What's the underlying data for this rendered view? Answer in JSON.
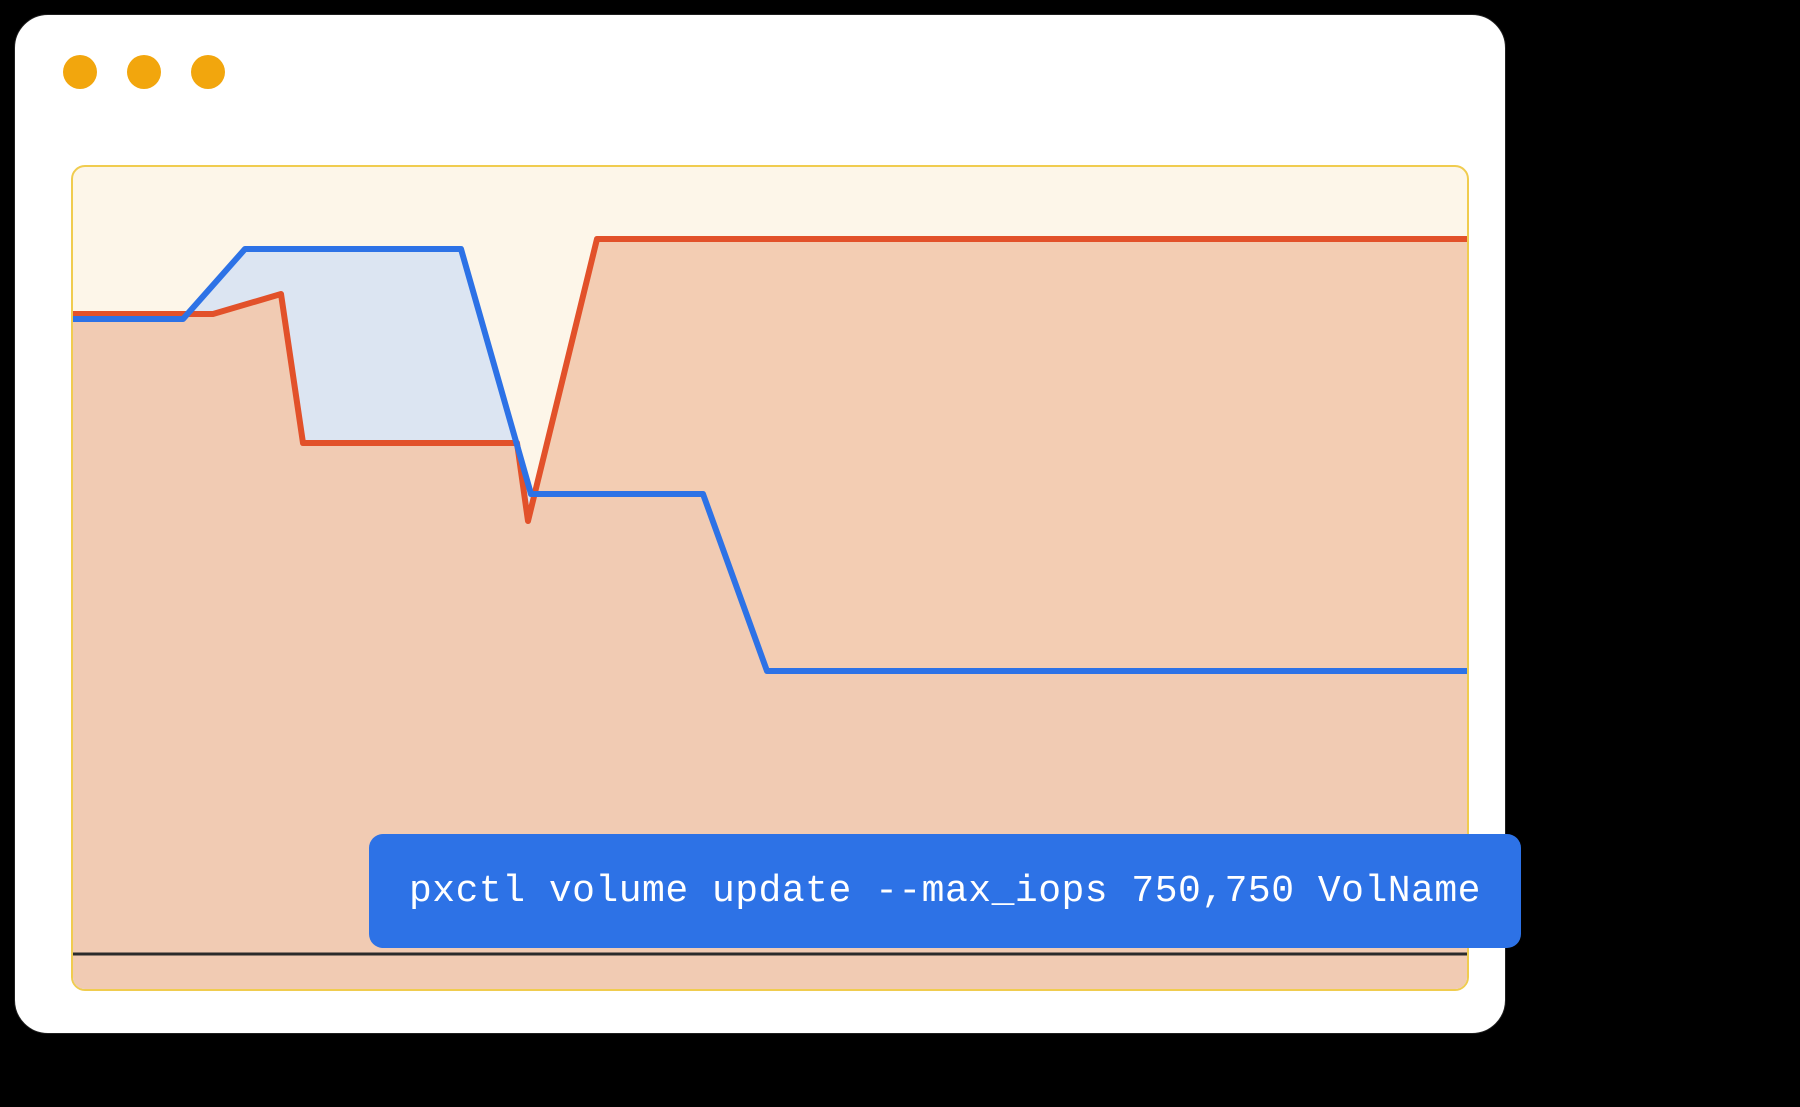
{
  "window": {
    "traffic_dot_color": "#f2a60d"
  },
  "command": {
    "text": "pxctl volume update --max_iops 750,750 VolName",
    "background": "#2d72e6",
    "text_color": "#ffffff"
  },
  "chart_data": {
    "type": "area",
    "title": "",
    "xlabel": "",
    "ylabel": "",
    "xlim": [
      0,
      1394
    ],
    "ylim": [
      0,
      822
    ],
    "grid": false,
    "floor_y": 0,
    "panel": {
      "background": "#fdf6e9",
      "border": "#f0cc4f"
    },
    "series": [
      {
        "name": "orange",
        "stroke": "#e2512a",
        "fill": "#f2c9ae",
        "points": [
          {
            "x": 0,
            "y": 675
          },
          {
            "x": 140,
            "y": 675
          },
          {
            "x": 208,
            "y": 695
          },
          {
            "x": 230,
            "y": 546
          },
          {
            "x": 444,
            "y": 546
          },
          {
            "x": 455,
            "y": 468
          },
          {
            "x": 524,
            "y": 750
          },
          {
            "x": 1394,
            "y": 750
          }
        ]
      },
      {
        "name": "blue",
        "stroke": "#2d72e6",
        "fill": "#dce5f2",
        "points": [
          {
            "x": 0,
            "y": 670
          },
          {
            "x": 110,
            "y": 670
          },
          {
            "x": 172,
            "y": 740
          },
          {
            "x": 388,
            "y": 740
          },
          {
            "x": 458,
            "y": 495
          },
          {
            "x": 630,
            "y": 495
          },
          {
            "x": 694,
            "y": 318
          },
          {
            "x": 1394,
            "y": 318
          }
        ]
      }
    ]
  }
}
